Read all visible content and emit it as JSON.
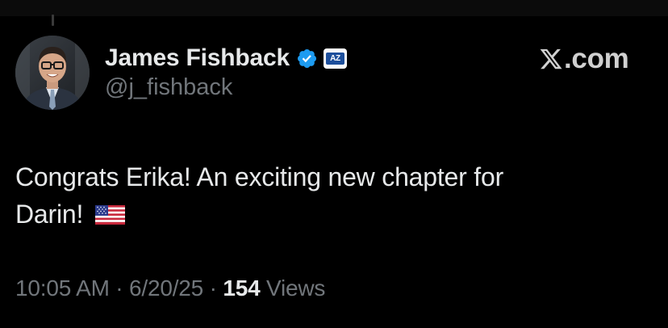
{
  "author": {
    "display_name": "James Fishback",
    "handle": "@j_fishback",
    "verified_icon": "verified-checkmark-icon",
    "affiliate_badge_text": "AZ",
    "avatar": "profile-photo"
  },
  "brand": {
    "logo_text": ".com",
    "logo_icon": "x-logo-icon"
  },
  "tweet": {
    "text_line1": "Congrats Erika! An exciting new chapter for",
    "text_line2": "Darin!",
    "emoji": "us-flag-icon"
  },
  "meta": {
    "time": "10:05 AM",
    "sep1": " · ",
    "date": "6/20/25",
    "sep2": " · ",
    "views_count": "154",
    "views_label": " Views"
  },
  "colors": {
    "background": "#000000",
    "text_primary": "#e7e9ea",
    "text_secondary": "#71767b",
    "verified_blue": "#1d9bf0"
  }
}
